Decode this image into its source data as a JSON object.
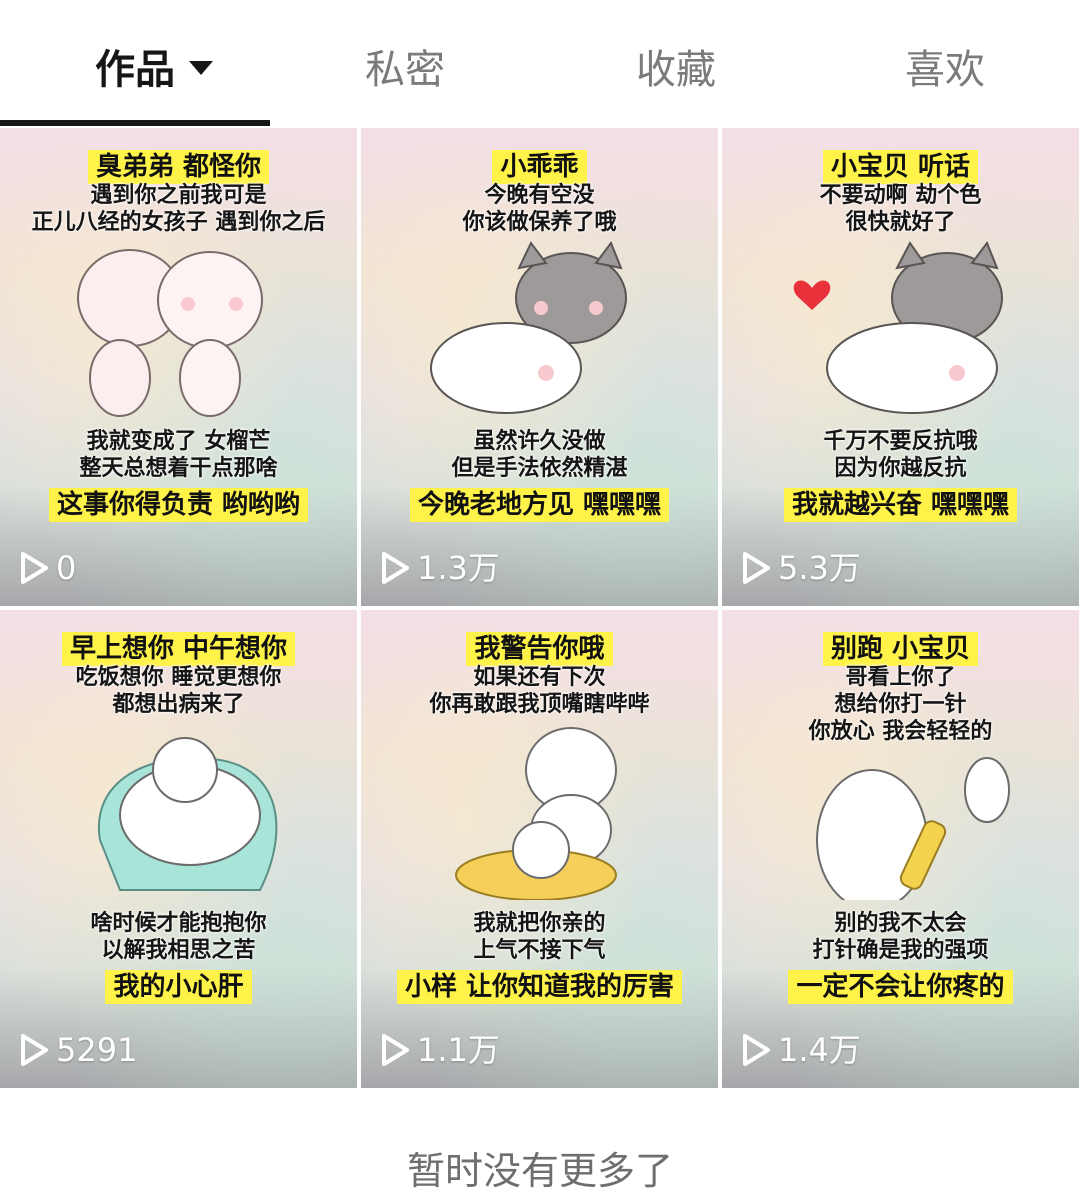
{
  "tabs": [
    {
      "label": "作品",
      "active": true
    },
    {
      "label": "私密",
      "active": false
    },
    {
      "label": "收藏",
      "active": false
    },
    {
      "label": "喜欢",
      "active": false
    }
  ],
  "cards": [
    {
      "headline": "臭弟弟 都怪你",
      "top_lines": [
        "遇到你之前我可是",
        "正儿八经的女孩子 遇到你之后"
      ],
      "bottom_lines": [
        "我就变成了 女榴芒",
        "整天总想着干点那啥"
      ],
      "footline": "这事你得负责 哟哟哟",
      "plays": "0"
    },
    {
      "headline": "小乖乖",
      "top_lines": [
        "今晚有空没",
        "你该做保养了哦"
      ],
      "bottom_lines": [
        "虽然许久没做",
        "但是手法依然精湛"
      ],
      "footline": "今晚老地方见 嘿嘿嘿",
      "plays": "1.3万"
    },
    {
      "headline": "小宝贝 听话",
      "top_lines": [
        "不要动啊 劫个色",
        "很快就好了"
      ],
      "bottom_lines": [
        "千万不要反抗哦",
        "因为你越反抗"
      ],
      "footline": "我就越兴奋 嘿嘿嘿",
      "plays": "5.3万"
    },
    {
      "headline": "早上想你 中午想你",
      "top_lines": [
        "吃饭想你 睡觉更想你",
        "都想出病来了"
      ],
      "bottom_lines": [
        "啥时候才能抱抱你",
        "以解我相思之苦"
      ],
      "footline": "我的小心肝",
      "plays": "5291"
    },
    {
      "headline": "我警告你哦",
      "top_lines": [
        "如果还有下次",
        "你再敢跟我顶嘴瞎哔哔"
      ],
      "bottom_lines": [
        "我就把你亲的",
        "上气不接下气"
      ],
      "footline": "小样 让你知道我的厉害",
      "plays": "1.1万"
    },
    {
      "headline": "别跑 小宝贝",
      "top_lines": [
        "哥看上你了",
        "想给你打一针",
        "你放心 我会轻轻的"
      ],
      "bottom_lines": [
        "别的我不太会",
        "打针确是我的强项"
      ],
      "footline": "一定不会让你疼的",
      "plays": "1.4万"
    }
  ],
  "footer": {
    "text": "暂时没有更多了"
  },
  "icons": {
    "play": "play-outline-icon",
    "dropdown": "caret-down-icon"
  }
}
